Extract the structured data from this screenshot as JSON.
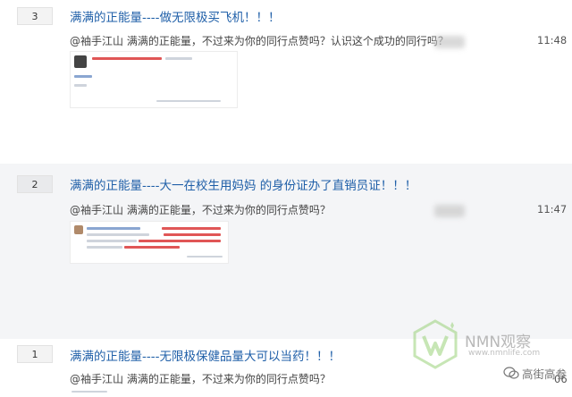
{
  "entries": [
    {
      "rank": "3",
      "title": "满满的正能量----做无限极买飞机！！！",
      "comment": "@袖手江山 满满的正能量，不过来为你的同行点赞吗？认识这个成功的同行吗？",
      "time": "11:48"
    },
    {
      "rank": "2",
      "title": "满满的正能量----大一在校生用妈妈 的身份证办了直销员证！！！",
      "comment": "@袖手江山 满满的正能量，不过来为你的同行点赞吗？",
      "time": "11:47"
    },
    {
      "rank": "1",
      "title": "满满的正能量----无限极保健品量大可以当药！！！",
      "comment": "@袖手江山 满满的正能量，不过来为你的同行点赞吗？",
      "time": "06"
    }
  ],
  "watermark": {
    "brand": "NMN观察",
    "url": "www.nmnlife.com",
    "account": "高街高参"
  },
  "colors": {
    "title": "#1f5fa8",
    "alt_row": "#f4f5f7"
  }
}
